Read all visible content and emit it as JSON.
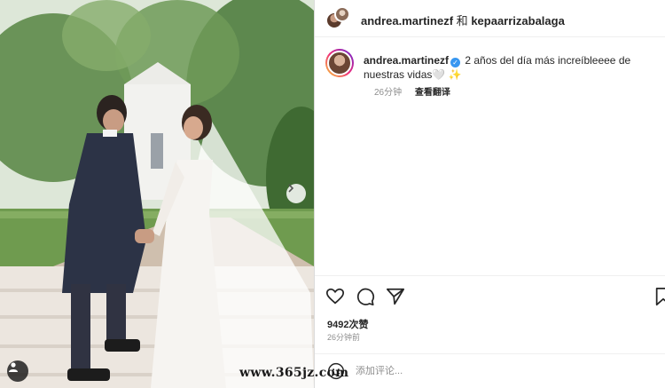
{
  "header": {
    "user1": "andrea.martinezf",
    "conjunction": "和",
    "user2": "kepaarrizabalaga"
  },
  "caption": {
    "username": "andrea.martinezf",
    "text": "2 años del día más increíbleeee de nuestras vidas🤍 ✨",
    "time": "26分钟",
    "translate": "查看翻译"
  },
  "stats": {
    "likes": "9492次赞",
    "time_ago": "26分钟前"
  },
  "comment": {
    "placeholder": "添加评论..."
  },
  "watermark": "www.365jz.com",
  "colors": {
    "verified": "#3897f0",
    "text": "#262626",
    "muted": "#8e8e8e"
  },
  "icons": [
    "like-icon",
    "comment-icon",
    "share-icon",
    "save-icon",
    "emoji-icon",
    "next-arrow-icon",
    "user-tag-icon",
    "verified-icon"
  ]
}
